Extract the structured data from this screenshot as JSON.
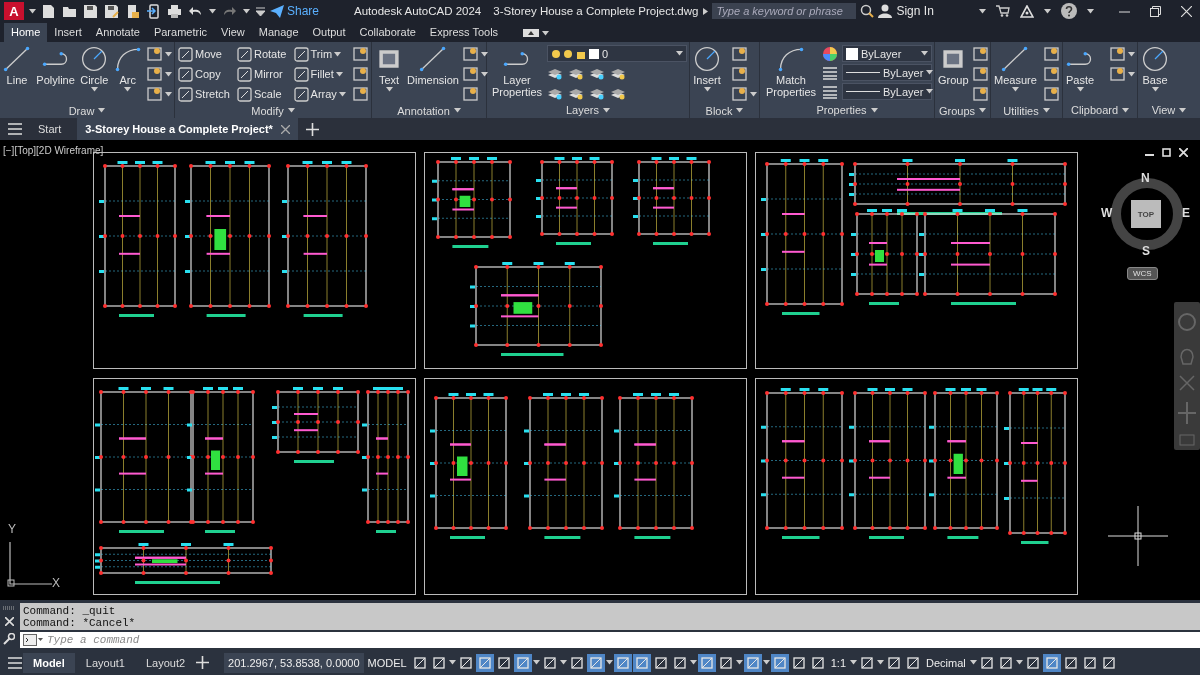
{
  "title_bar": {
    "logo": "A",
    "share": "Share",
    "app_title": "Autodesk AutoCAD 2024",
    "document_title": "3-Storey House a Complete Project.dwg",
    "search": {
      "placeholder": "Type a keyword or phrase"
    },
    "sign_in": "Sign In"
  },
  "ribbon_tabs": [
    {
      "label": "Home",
      "selected": true
    },
    {
      "label": "Insert",
      "selected": false
    },
    {
      "label": "Annotate",
      "selected": false
    },
    {
      "label": "Parametric",
      "selected": false
    },
    {
      "label": "View",
      "selected": false
    },
    {
      "label": "Manage",
      "selected": false
    },
    {
      "label": "Output",
      "selected": false
    },
    {
      "label": "Collaborate",
      "selected": false
    },
    {
      "label": "Express Tools",
      "selected": false
    }
  ],
  "ribbon_panels": [
    {
      "title": "Draw",
      "columns": [
        [
          {
            "kind": "large",
            "label": "Line",
            "caret": false
          }
        ],
        [
          {
            "kind": "large",
            "label": "Polyline",
            "caret": false
          }
        ],
        [
          {
            "kind": "large",
            "label": "Circle",
            "caret": true
          }
        ],
        [
          {
            "kind": "large",
            "label": "Arc",
            "caret": true
          }
        ],
        [
          {
            "kind": "icon",
            "caret": true
          },
          {
            "kind": "icon",
            "caret": true
          },
          {
            "kind": "icon",
            "caret": true
          }
        ]
      ]
    },
    {
      "title": "Modify",
      "columns": [
        [
          {
            "kind": "small",
            "label": "Move",
            "caret": false
          },
          {
            "kind": "small",
            "label": "Copy",
            "caret": false
          },
          {
            "kind": "small",
            "label": "Stretch",
            "caret": false
          }
        ],
        [
          {
            "kind": "small",
            "label": "Rotate",
            "caret": false
          },
          {
            "kind": "small",
            "label": "Mirror",
            "caret": false
          },
          {
            "kind": "small",
            "label": "Scale",
            "caret": false
          }
        ],
        [
          {
            "kind": "small",
            "label": "Trim",
            "caret": true
          },
          {
            "kind": "small",
            "label": "Fillet",
            "caret": true
          },
          {
            "kind": "small",
            "label": "Array",
            "caret": true
          }
        ],
        [
          {
            "kind": "icon",
            "caret": false
          },
          {
            "kind": "icon",
            "caret": false
          },
          {
            "kind": "icon",
            "caret": false
          }
        ]
      ]
    },
    {
      "title": "Annotation",
      "columns": [
        [
          {
            "kind": "large",
            "label": "Text",
            "caret": true
          }
        ],
        [
          {
            "kind": "large",
            "label": "Dimension",
            "caret": false
          }
        ],
        [
          {
            "kind": "icon",
            "caret": true
          },
          {
            "kind": "icon",
            "caret": true
          },
          {
            "kind": "icon",
            "caret": false
          }
        ]
      ]
    },
    {
      "title": "Layers",
      "columns": [
        [
          {
            "kind": "large",
            "label": "Layer Properties",
            "caret": false
          }
        ],
        [
          {
            "kind": "layer_dropdown",
            "value": "0"
          },
          {
            "kind": "icon_row"
          },
          {
            "kind": "icon_row"
          }
        ]
      ]
    },
    {
      "title": "Block",
      "columns": [
        [
          {
            "kind": "large",
            "label": "Insert",
            "caret": true
          }
        ],
        [
          {
            "kind": "icon",
            "caret": false
          },
          {
            "kind": "icon",
            "caret": false
          },
          {
            "kind": "icon",
            "caret": true
          }
        ]
      ]
    },
    {
      "title": "Properties",
      "columns": [
        [
          {
            "kind": "large",
            "label": "Match Properties",
            "caret": false
          }
        ],
        [
          {
            "kind": "color_dropdown",
            "value": "ByLayer"
          },
          {
            "kind": "line_dropdown",
            "value": "ByLayer"
          },
          {
            "kind": "line_dropdown",
            "value": "ByLayer"
          }
        ]
      ]
    },
    {
      "title": "Groups",
      "columns": [
        [
          {
            "kind": "large",
            "label": "Group",
            "caret": false
          }
        ],
        [
          {
            "kind": "icon",
            "caret": false
          },
          {
            "kind": "icon",
            "caret": false
          },
          {
            "kind": "icon",
            "caret": false
          }
        ]
      ]
    },
    {
      "title": "Utilities",
      "columns": [
        [
          {
            "kind": "large",
            "label": "Measure",
            "caret": true
          }
        ],
        [
          {
            "kind": "icon",
            "caret": false
          },
          {
            "kind": "icon",
            "caret": false
          },
          {
            "kind": "icon",
            "caret": false
          }
        ]
      ]
    },
    {
      "title": "Clipboard",
      "columns": [
        [
          {
            "kind": "large",
            "label": "Paste",
            "caret": true
          }
        ],
        [
          {
            "kind": "icon",
            "caret": true
          },
          {
            "kind": "icon",
            "caret": true
          }
        ]
      ]
    },
    {
      "title": "View",
      "columns": [
        [
          {
            "kind": "large",
            "label": "Base",
            "caret": true
          }
        ]
      ]
    }
  ],
  "document_tabs": [
    {
      "label": "Start",
      "selected": false
    },
    {
      "label": "3-Storey House a Complete Project*",
      "selected": true
    }
  ],
  "viewport": {
    "label": "[−][Top][2D Wireframe]",
    "viewcube": {
      "north": "N",
      "south": "S",
      "east": "E",
      "west": "W",
      "face": "TOP",
      "ucs": "WCS"
    },
    "ucs_icon": {
      "x": "X",
      "y": "Y"
    }
  },
  "command_line": {
    "history": [
      "Command: _quit",
      "Command: *Cancel*"
    ],
    "placeholder": "Type a command"
  },
  "status_bar": {
    "layout_tabs": [
      {
        "label": "Model",
        "selected": true
      },
      {
        "label": "Layout1",
        "selected": false
      },
      {
        "label": "Layout2",
        "selected": false
      }
    ],
    "coordinates": "201.2967, 53.8538, 0.0000",
    "space": "MODEL",
    "items": [
      {
        "kind": "toggle",
        "on": false
      },
      {
        "kind": "toggle",
        "on": false
      },
      {
        "kind": "caret"
      },
      {
        "kind": "toggle",
        "on": false
      },
      {
        "kind": "toggle",
        "on": true
      },
      {
        "kind": "toggle",
        "on": false
      },
      {
        "kind": "toggle",
        "on": true
      },
      {
        "kind": "caret"
      },
      {
        "kind": "toggle",
        "on": false
      },
      {
        "kind": "caret"
      },
      {
        "kind": "toggle",
        "on": false
      },
      {
        "kind": "toggle",
        "on": true
      },
      {
        "kind": "caret"
      },
      {
        "kind": "toggle",
        "on": true
      },
      {
        "kind": "toggle",
        "on": true
      },
      {
        "kind": "toggle",
        "on": false
      },
      {
        "kind": "toggle",
        "on": false
      },
      {
        "kind": "caret"
      },
      {
        "kind": "toggle",
        "on": true
      },
      {
        "kind": "toggle",
        "on": false
      },
      {
        "kind": "caret"
      },
      {
        "kind": "toggle",
        "on": true
      },
      {
        "kind": "caret"
      },
      {
        "kind": "toggle",
        "on": true
      },
      {
        "kind": "toggle",
        "on": false
      },
      {
        "kind": "toggle",
        "on": false
      },
      {
        "kind": "text",
        "label": "1:1"
      },
      {
        "kind": "caret"
      },
      {
        "kind": "toggle",
        "on": false
      },
      {
        "kind": "caret"
      },
      {
        "kind": "toggle",
        "on": false
      },
      {
        "kind": "toggle",
        "on": false
      },
      {
        "kind": "text",
        "label": "Decimal"
      },
      {
        "kind": "caret"
      },
      {
        "kind": "toggle",
        "on": false
      },
      {
        "kind": "toggle",
        "on": false
      },
      {
        "kind": "caret"
      },
      {
        "kind": "toggle",
        "on": false
      },
      {
        "kind": "toggle",
        "on": true
      },
      {
        "kind": "toggle",
        "on": false
      },
      {
        "kind": "toggle",
        "on": false
      },
      {
        "kind": "toggle",
        "on": false
      }
    ]
  }
}
